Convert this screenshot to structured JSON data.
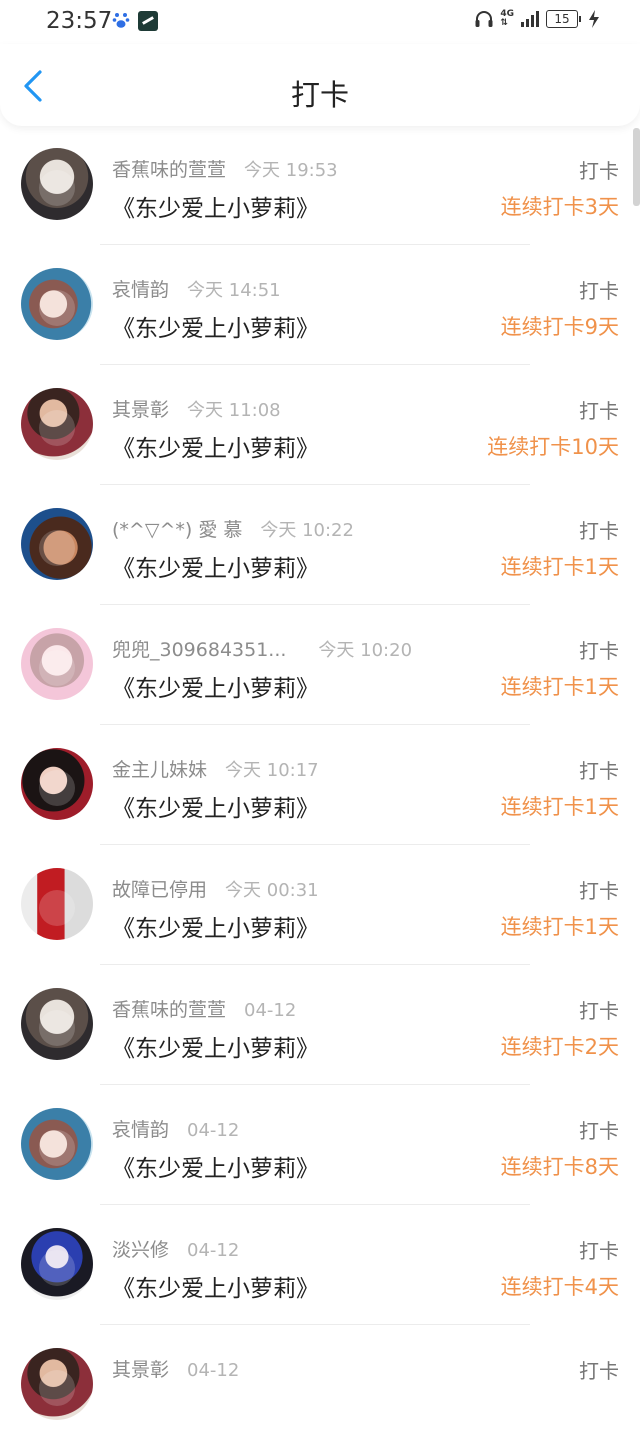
{
  "status_bar": {
    "time": "23:57",
    "network": "4G",
    "battery": "15",
    "icons": [
      "baidu-paw-icon",
      "app-notification-icon",
      "headphones-icon",
      "signal-icon",
      "charging-icon"
    ]
  },
  "header": {
    "title": "打卡",
    "back_icon": "chevron-left-icon",
    "accent_color": "#2196f3"
  },
  "colors": {
    "streak": "#f0924b",
    "name": "#8c8c8c",
    "time": "#b4b4b4"
  },
  "items": [
    {
      "name": "香蕉味的萱萱",
      "time": "今天 19:53",
      "book": "《东少爱上小萝莉》",
      "action": "打卡",
      "streak": "连续打卡3天",
      "avatar": "avatar-boy-icon"
    },
    {
      "name": "哀情韵",
      "time": "今天 14:51",
      "book": "《东少爱上小萝莉》",
      "action": "打卡",
      "streak": "连续打卡9天",
      "avatar": "avatar-couple-icon"
    },
    {
      "name": "其景彰",
      "time": "今天 11:08",
      "book": "《东少爱上小萝莉》",
      "action": "打卡",
      "streak": "连续打卡10天",
      "avatar": "avatar-photo-icon"
    },
    {
      "name": "(*^▽^*) 愛 慕",
      "time": "今天 10:22",
      "book": "《东少爱上小萝莉》",
      "action": "打卡",
      "streak": "连续打卡1天",
      "avatar": "avatar-anime-warrior-icon"
    },
    {
      "name": "兜兜_309684351...",
      "time": "今天 10:20",
      "book": "《东少爱上小萝莉》",
      "action": "打卡",
      "streak": "连续打卡1天",
      "avatar": "avatar-anime-girl-icon"
    },
    {
      "name": "金主儿妹妹",
      "time": "今天 10:17",
      "book": "《东少爱上小萝莉》",
      "action": "打卡",
      "streak": "连续打卡1天",
      "avatar": "avatar-anime-dark-icon"
    },
    {
      "name": "故障已停用",
      "time": "今天 00:31",
      "book": "《东少爱上小萝莉》",
      "action": "打卡",
      "streak": "连续打卡1天",
      "avatar": "avatar-bottle-icon"
    },
    {
      "name": "香蕉味的萱萱",
      "time": "04-12",
      "book": "《东少爱上小萝莉》",
      "action": "打卡",
      "streak": "连续打卡2天",
      "avatar": "avatar-boy-icon"
    },
    {
      "name": "哀情韵",
      "time": "04-12",
      "book": "《东少爱上小萝莉》",
      "action": "打卡",
      "streak": "连续打卡8天",
      "avatar": "avatar-couple-icon"
    },
    {
      "name": "淡兴修",
      "time": "04-12",
      "book": "《东少爱上小萝莉》",
      "action": "打卡",
      "streak": "连续打卡4天",
      "avatar": "avatar-anime-blue-icon"
    },
    {
      "name": "其景彰",
      "time": "04-12",
      "book": "",
      "action": "打卡",
      "streak": "",
      "avatar": "avatar-photo-icon"
    }
  ]
}
